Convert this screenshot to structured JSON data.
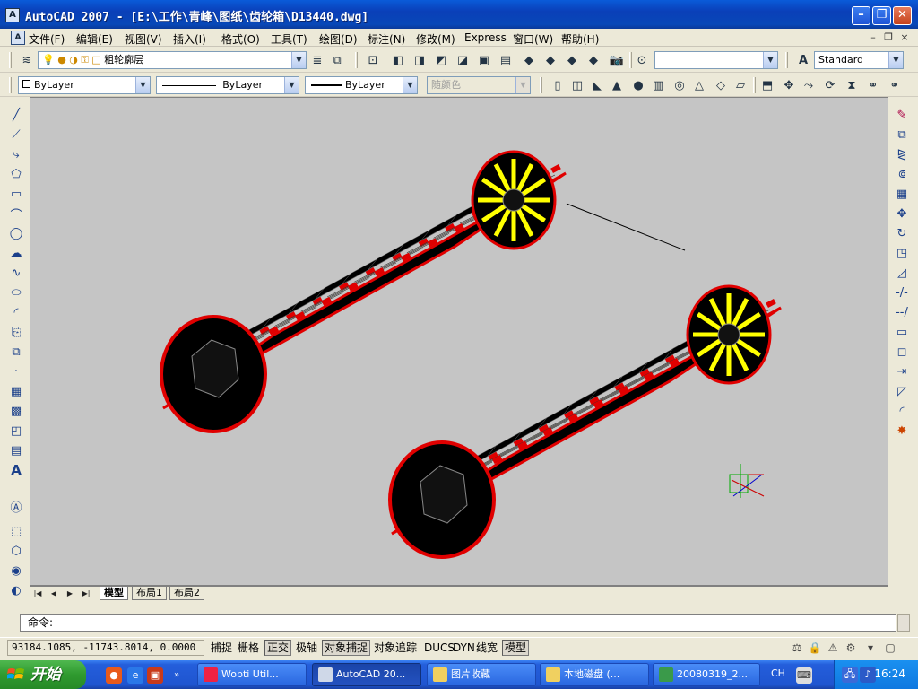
{
  "window": {
    "title": "AutoCAD 2007 - [E:\\工作\\青峰\\图纸\\齿轮箱\\D13440.dwg]",
    "app_icon": "autocad-icon",
    "controls": [
      "minimize",
      "maximize",
      "close"
    ]
  },
  "menubar": {
    "items": [
      "文件(F)",
      "编辑(E)",
      "视图(V)",
      "插入(I)",
      "格式(O)",
      "工具(T)",
      "绘图(D)",
      "标注(N)",
      "修改(M)",
      "Express",
      "窗口(W)",
      "帮助(H)"
    ],
    "mdi_controls": [
      "–",
      "❐",
      "×"
    ]
  },
  "toolbar1": {
    "layer_combo": "粗轮廓层",
    "view_combo": "",
    "text_style_combo": "Standard"
  },
  "toolbar2": {
    "color_combo": "ByLayer",
    "linetype_combo": "ByLayer",
    "lineweight_combo": "ByLayer",
    "plotstyle_combo": "随颜色"
  },
  "layout_tabs": {
    "tabs": [
      "模型",
      "布局1",
      "布局2"
    ],
    "active": "模型"
  },
  "command": {
    "prompt": "命令:"
  },
  "statusbar": {
    "coords": "93184.1085, -11743.8014, 0.0000",
    "modes": [
      {
        "label": "捕捉",
        "on": false
      },
      {
        "label": "栅格",
        "on": false
      },
      {
        "label": "正交",
        "on": true
      },
      {
        "label": "极轴",
        "on": false
      },
      {
        "label": "对象捕捉",
        "on": true
      },
      {
        "label": "对象追踪",
        "on": false
      },
      {
        "label": "DUCS",
        "on": false
      },
      {
        "label": "DYN",
        "on": false
      },
      {
        "label": "线宽",
        "on": false
      },
      {
        "label": "模型",
        "on": true
      }
    ]
  },
  "taskbar": {
    "start_label": "开始",
    "tasks": [
      {
        "label": "Wopti Util...",
        "active": false,
        "icon": "wopti-icon"
      },
      {
        "label": "AutoCAD 20...",
        "active": true,
        "icon": "autocad-icon"
      },
      {
        "label": "图片收藏",
        "active": false,
        "icon": "folder-icon"
      },
      {
        "label": "本地磁盘 (...",
        "active": false,
        "icon": "folder-icon"
      },
      {
        "label": "20080319_2...",
        "active": false,
        "icon": "image-icon"
      }
    ],
    "ime": "CH",
    "clock": "16:24"
  },
  "colors": {
    "track_red": "#e00000",
    "track_yellow": "#ffff00",
    "track_black": "#000000",
    "canvas_bg": "#c5c5c5",
    "title_blue": "#0a4ac8"
  }
}
